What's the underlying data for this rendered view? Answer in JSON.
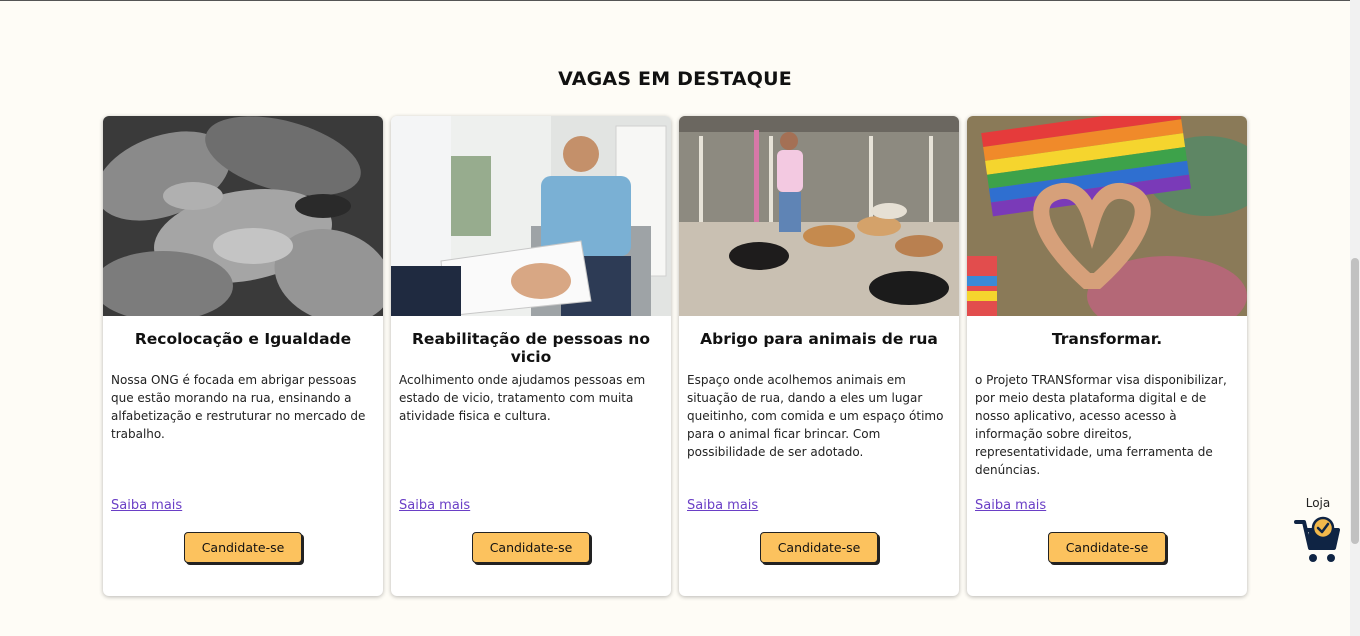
{
  "section": {
    "title": "VAGAS EM DESTAQUE"
  },
  "cards": [
    {
      "title": "Recolocação e Igualdade",
      "text": "Nossa ONG é focada em abrigar pessoas que estão morando na rua, ensinando a alfabetização e restruturar no mercado de trabalho.",
      "link": "Saiba mais",
      "button": "Candidate-se"
    },
    {
      "title": "Reabilitação de pessoas no vicio",
      "text": "Acolhimento onde ajudamos pessoas em estado de vicio, tratamento com muita atividade fisica e cultura.",
      "link": "Saiba mais",
      "button": "Candidate-se"
    },
    {
      "title": "Abrigo para animais de rua",
      "text": "Espaço onde acolhemos animais em situação de rua, dando a eles um lugar queitinho, com comida e um espaço ótimo para o animal ficar brincar. Com possibilidade de ser adotado.",
      "link": "Saiba mais",
      "button": "Candidate-se"
    },
    {
      "title": "Transformar.",
      "text": "o Projeto TRANSformar visa disponibilizar, por meio desta plataforma digital e de nosso aplicativo, acesso acesso à informação sobre direitos, representatividade, uma ferramenta de denúncias.",
      "link": "Saiba mais",
      "button": "Candidate-se"
    }
  ],
  "store": {
    "label": "Loja",
    "icon": "shopping-cart-check-icon"
  },
  "colors": {
    "background": "#fefcf6",
    "button": "#fcc25e",
    "link": "#6a3fc6",
    "cart": "#0f2444",
    "cart_badge": "#f2b84b"
  }
}
